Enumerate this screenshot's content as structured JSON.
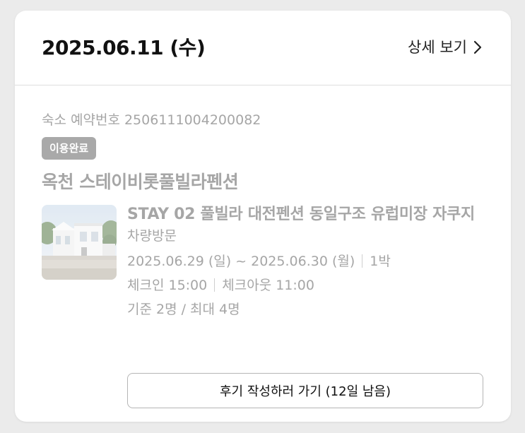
{
  "header": {
    "date": "2025.06.11 (수)",
    "detail_link": "상세 보기"
  },
  "reservation": {
    "number_text": "숙소 예약번호 2506111004200082",
    "status_badge": "이용완료",
    "property_name": "옥천 스테이비롯풀빌라펜션",
    "room_name": "STAY 02 풀빌라 대전펜션 동일구조 유럽미장 자쿠지",
    "visit_type": "차량방문",
    "stay_dates": "2025.06.29 (일) ~ 2025.06.30 (월)",
    "nights": "1박",
    "checkin": "체크인 15:00",
    "checkout": "체크아웃 11:00",
    "guests": "기준 2명 / 최대 4명"
  },
  "actions": {
    "review_button": "후기 작성하러 가기 (12일 남음)"
  },
  "icons": {
    "detail_chevron": "chevron-right-icon",
    "thumbnail": "property-photo"
  },
  "colors": {
    "card_bg": "#ffffff",
    "page_bg": "#ebebeb",
    "muted_text": "#a6a6a6",
    "badge_bg": "#a9a9a9",
    "primary_text": "#111111"
  }
}
